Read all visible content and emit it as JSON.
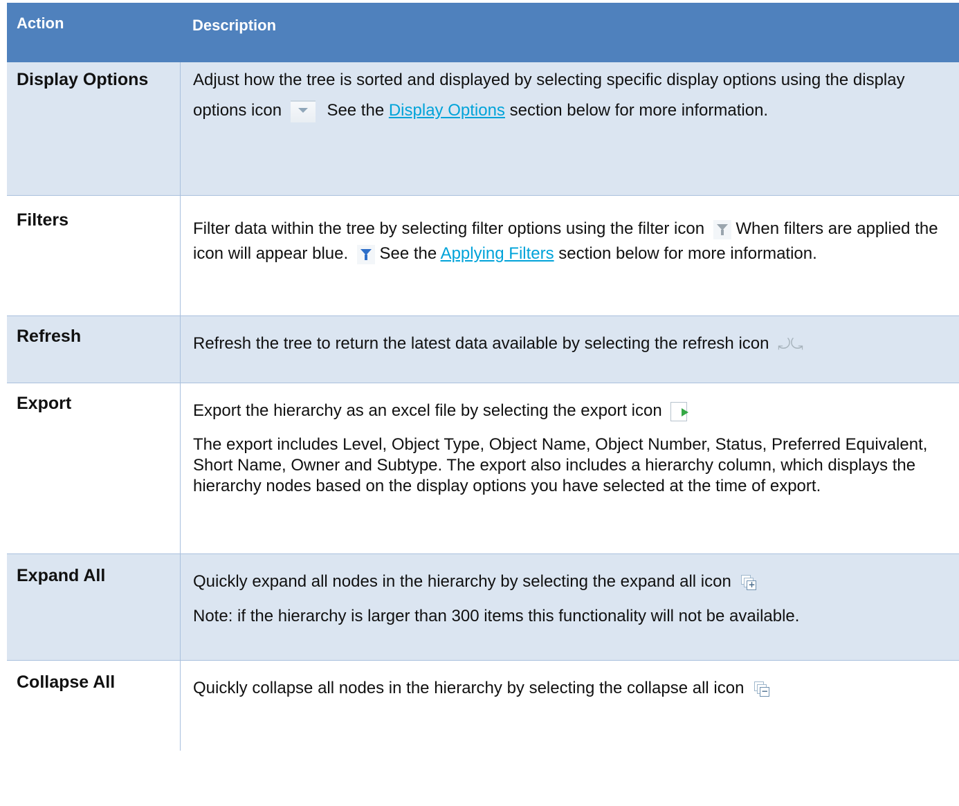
{
  "table": {
    "headers": {
      "action": "Action",
      "description": "Description"
    },
    "rows": [
      {
        "action": "Display Options",
        "text1": "Adjust how the tree is sorted and displayed by selecting specific display options using the display options icon",
        "text2": "See the",
        "link": "Display Options",
        "text3": "section below for more information.",
        "icon": "dropdown-chevron-icon"
      },
      {
        "action": "Filters",
        "text1": "Filter data within the tree by selecting filter options using the filter icon",
        "text2": "When filters are applied the icon will appear blue.",
        "text3": "See the",
        "link": "Applying Filters",
        "text4": "section below for more information.",
        "icon": "filter-icon",
        "icon_active": "filter-active-icon",
        "icon_active_color": "#2e6fc9"
      },
      {
        "action": "Refresh",
        "text1": "Refresh the tree to return the latest data available by selecting the refresh icon",
        "icon": "refresh-icon"
      },
      {
        "action": "Export",
        "text1": "Export the hierarchy as an excel file by selecting the export icon",
        "text2": "The export includes Level, Object Type, Object Name, Object Number, Status, Preferred Equivalent, Short Name, Owner and Subtype. The export also includes a hierarchy column, which displays the hierarchy nodes based on the display options you have selected at the time of export.",
        "icon": "export-icon"
      },
      {
        "action": "Expand All",
        "text1": "Quickly expand all nodes in the hierarchy by selecting the expand all icon",
        "text2": "Note: if the hierarchy is larger than 300 items this functionality will not be available.",
        "icon": "expand-all-icon",
        "icon_glyph": "+"
      },
      {
        "action": "Collapse All",
        "text1": "Quickly collapse all nodes in the hierarchy by selecting the collapse all icon",
        "icon": "collapse-all-icon",
        "icon_glyph": "−"
      }
    ]
  },
  "colors": {
    "header_bg": "#4f81bd",
    "shaded_row_bg": "#dbe5f1",
    "link": "#00a3d9",
    "border": "#a9c0dd"
  },
  "refresh_glyph": "⤾⤿"
}
